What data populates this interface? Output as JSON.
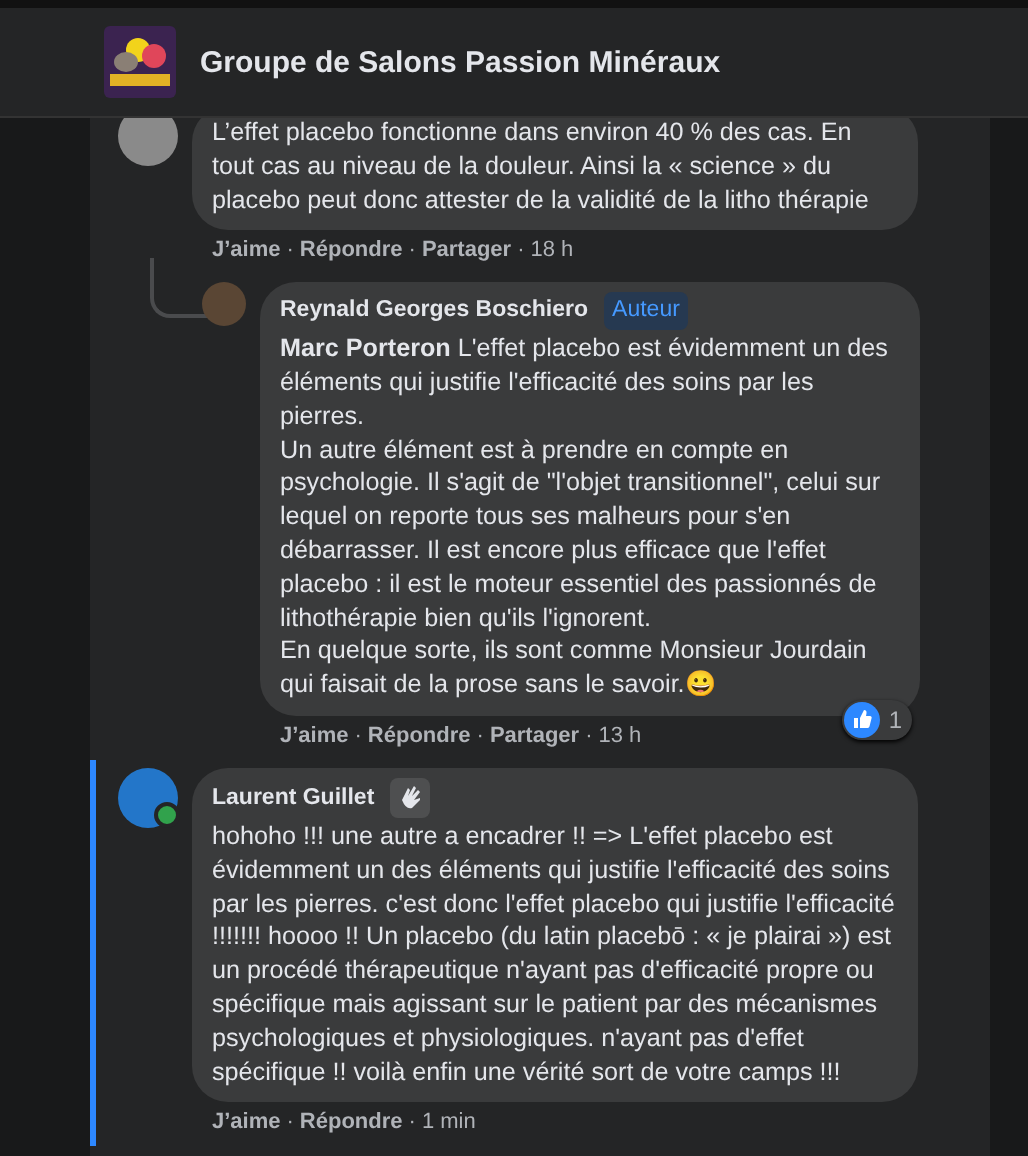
{
  "header": {
    "title": "Groupe de Salons Passion Minéraux"
  },
  "separator": "·",
  "comments": [
    {
      "kind": "comment",
      "highlighted": false,
      "online": false,
      "paragraphs": [
        "L’effet placebo fonctionne dans environ 40 % des cas. En tout cas au niveau de la douleur. Ainsi la « science » du placebo peut donc attester de la validité de la litho thérapie"
      ],
      "actions": [
        "J’aime",
        "Répondre",
        "Partager"
      ],
      "time": "18 h"
    },
    {
      "kind": "reply",
      "author": "Reynald Georges Boschiero",
      "badge": "Auteur",
      "highlighted": false,
      "online": false,
      "paragraphs": [
        "**Marc Porteron** L'effet placebo est évidemment un des éléments qui justifie l'efficacité des soins par les pierres.",
        "Un autre élément est à prendre en compte en psychologie. Il s'agit de \"l'objet transitionnel\", celui sur lequel on reporte tous ses malheurs pour s'en débarrasser. Il est encore plus efficace que l'effet placebo : il est le moteur essentiel des passionnés de lithothérapie bien qu'ils l'ignorent.",
        "En quelque sorte, ils sont comme Monsieur Jourdain qui faisait de la prose sans le savoir.😀"
      ],
      "actions": [
        "J’aime",
        "Répondre",
        "Partager"
      ],
      "time": "13 h",
      "reactions": "1"
    },
    {
      "kind": "comment",
      "author": "Laurent Guillet",
      "highlighted": true,
      "online": true,
      "paragraphs": [
        "hohoho !!! une autre a encadrer !! => L'effet placebo est évidemment un des éléments qui justifie l'efficacité des soins par les pierres. c'est donc l'effet placebo qui justifie l'efficacité !!!!!!! hoooo !! Un placebo (du latin placebō : « je plairai ») est un procédé thérapeutique n'ayant pas d'efficacité propre ou spécifique mais agissant sur le patient par des mécanismes psychologiques et physiologiques. n'ayant pas d'effet spécifique !! voilà enfin une vérité sort de votre camps !!!"
      ],
      "actions": [
        "J’aime",
        "Répondre"
      ],
      "time": "1 min"
    }
  ]
}
